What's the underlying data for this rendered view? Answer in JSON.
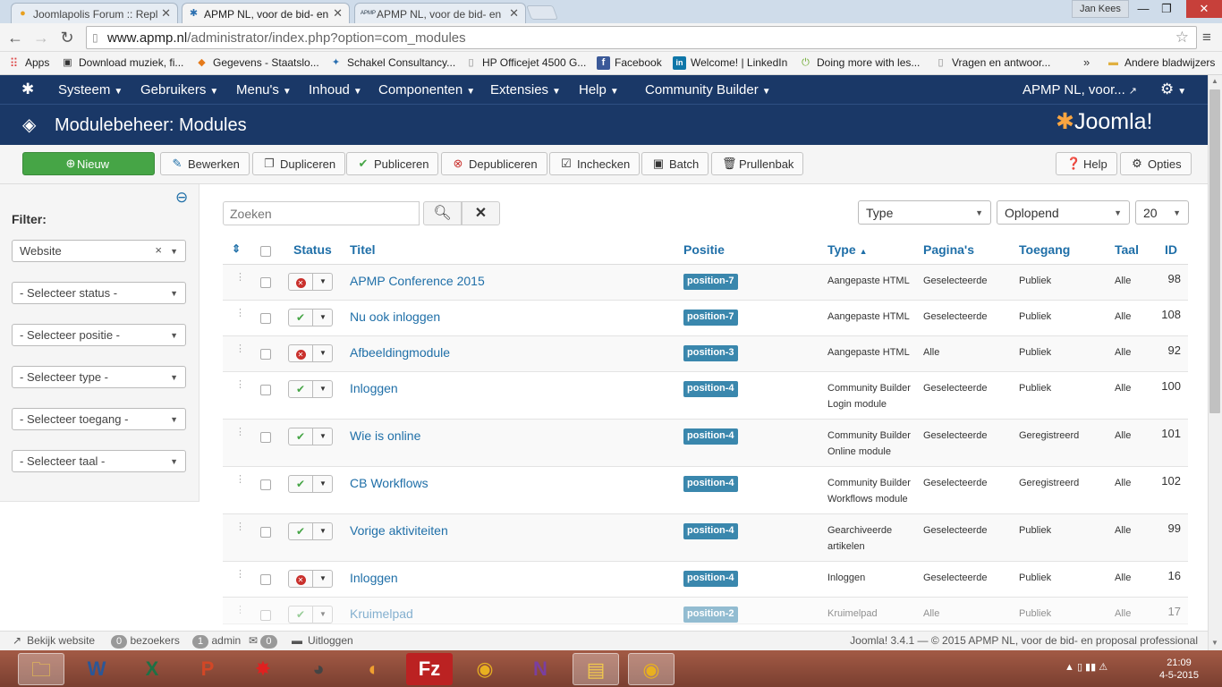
{
  "browser": {
    "tabs": [
      {
        "label": "Joomlapolis Forum :: Repl",
        "icon": "joomlapolis-icon",
        "active": false
      },
      {
        "label": "APMP NL, voor de bid- en",
        "icon": "joomla-icon",
        "active": true
      },
      {
        "label": "APMP NL, voor de bid- en",
        "icon": "apmp-icon",
        "active": false
      }
    ],
    "user": "Jan Kees",
    "url_prefix": "www.apmp.nl",
    "url_rest": "/administrator/index.php?option=com_modules",
    "bookmarks": [
      {
        "label": "Apps",
        "icon": "apps-icon"
      },
      {
        "label": "Download muziek, fi...",
        "icon": "download-icon"
      },
      {
        "label": "Gegevens - Staatslo...",
        "icon": "staatsloterij-icon"
      },
      {
        "label": "Schakel Consultancy...",
        "icon": "schakel-icon"
      },
      {
        "label": "HP Officejet 4500 G...",
        "icon": "page-icon"
      },
      {
        "label": "Facebook",
        "icon": "facebook-icon"
      },
      {
        "label": "Welcome! | LinkedIn",
        "icon": "linkedin-icon"
      },
      {
        "label": "Doing more with les...",
        "icon": "power-icon"
      },
      {
        "label": "Vragen en antwoor...",
        "icon": "page-icon"
      }
    ],
    "bookmarks_more": "»",
    "other_bookmarks": "Andere bladwijzers"
  },
  "nav": {
    "items": [
      "Systeem",
      "Gebruikers",
      "Menu's",
      "Inhoud",
      "Componenten",
      "Extensies",
      "Help",
      "Community Builder"
    ],
    "site": "APMP NL, voor..."
  },
  "header": {
    "title": "Modulebeheer: Modules",
    "logo": "Joomla!"
  },
  "toolbar": {
    "new": "Nieuw",
    "edit": "Bewerken",
    "duplicate": "Dupliceren",
    "publish": "Publiceren",
    "unpublish": "Depubliceren",
    "checkin": "Inchecken",
    "batch": "Batch",
    "trash": "Prullenbak",
    "help": "Help",
    "options": "Opties"
  },
  "sidebar": {
    "filter_label": "Filter:",
    "client": "Website",
    "status": "- Selecteer status -",
    "position": "- Selecteer positie -",
    "type": "- Selecteer type -",
    "access": "- Selecteer toegang -",
    "language": "- Selecteer taal -"
  },
  "search": {
    "placeholder": "Zoeken"
  },
  "list_controls": {
    "sort_field": "Type",
    "sort_dir": "Oplopend",
    "limit": "20"
  },
  "table": {
    "headers": {
      "status": "Status",
      "title": "Titel",
      "position": "Positie",
      "type": "Type",
      "pages": "Pagina's",
      "access": "Toegang",
      "language": "Taal",
      "id": "ID"
    },
    "rows": [
      {
        "published": false,
        "title": "APMP Conference 2015",
        "position": "position-7",
        "type1": "Aangepaste HTML",
        "type2": "",
        "pages": "Geselecteerde",
        "access": "Publiek",
        "language": "Alle",
        "id": "98"
      },
      {
        "published": true,
        "title": "Nu ook inloggen",
        "position": "position-7",
        "type1": "Aangepaste HTML",
        "type2": "",
        "pages": "Geselecteerde",
        "access": "Publiek",
        "language": "Alle",
        "id": "108"
      },
      {
        "published": false,
        "title": "Afbeeldingmodule",
        "position": "position-3",
        "type1": "Aangepaste HTML",
        "type2": "",
        "pages": "Alle",
        "access": "Publiek",
        "language": "Alle",
        "id": "92"
      },
      {
        "published": true,
        "title": "Inloggen",
        "position": "position-4",
        "type1": "Community Builder",
        "type2": "Login module",
        "pages": "Geselecteerde",
        "access": "Publiek",
        "language": "Alle",
        "id": "100"
      },
      {
        "published": true,
        "title": "Wie is online",
        "position": "position-4",
        "type1": "Community Builder",
        "type2": "Online module",
        "pages": "Geselecteerde",
        "access": "Geregistreerd",
        "language": "Alle",
        "id": "101"
      },
      {
        "published": true,
        "title": "CB Workflows",
        "position": "position-4",
        "type1": "Community Builder",
        "type2": "Workflows module",
        "pages": "Geselecteerde",
        "access": "Geregistreerd",
        "language": "Alle",
        "id": "102"
      },
      {
        "published": true,
        "title": "Vorige aktiviteiten",
        "position": "position-4",
        "type1": "Gearchiveerde",
        "type2": "artikelen",
        "pages": "Geselecteerde",
        "access": "Publiek",
        "language": "Alle",
        "id": "99"
      },
      {
        "published": false,
        "title": "Inloggen",
        "position": "position-4",
        "type1": "Inloggen",
        "type2": "",
        "pages": "Geselecteerde",
        "access": "Publiek",
        "language": "Alle",
        "id": "16"
      },
      {
        "published": true,
        "title": "Kruimelpad",
        "position": "position-2",
        "type1": "Kruimelpad",
        "type2": "",
        "pages": "Alle",
        "access": "Publiek",
        "language": "Alle",
        "id": "17"
      }
    ]
  },
  "statusbar": {
    "view_site": "Bekijk website",
    "visitors_count": "0",
    "visitors": "bezoekers",
    "admin_count": "1",
    "admin": "admin",
    "messages_count": "0",
    "logout": "Uitloggen",
    "footer": "Joomla! 3.4.1 — © 2015 APMP NL, voor de bid- en proposal professional"
  },
  "taskbar": {
    "time": "21:09",
    "date": "4-5-2015"
  },
  "colors": {
    "nav_bg": "#1a3867",
    "new_button": "#46a546",
    "link": "#1f6fa8",
    "badge": "#3a87ad",
    "unpublished": "#c9302c"
  }
}
